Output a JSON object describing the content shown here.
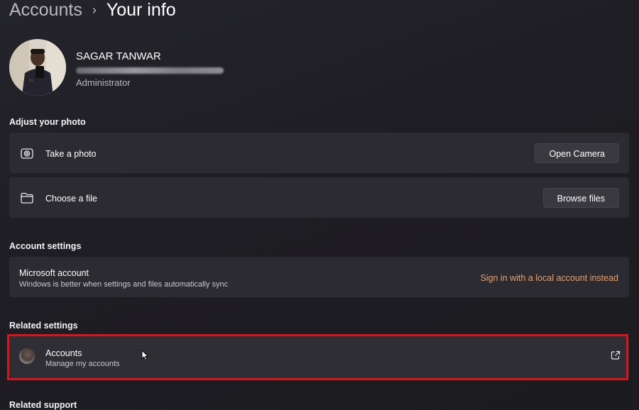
{
  "breadcrumb": {
    "parent": "Accounts",
    "separator": "›",
    "current": "Your info"
  },
  "profile": {
    "name": "SAGAR TANWAR",
    "role": "Administrator"
  },
  "adjust_photo": {
    "title": "Adjust your photo",
    "rows": [
      {
        "label": "Take a photo",
        "icon": "camera-icon",
        "button": "Open Camera"
      },
      {
        "label": "Choose a file",
        "icon": "folder-icon",
        "button": "Browse files"
      }
    ]
  },
  "account_settings": {
    "title": "Account settings",
    "label": "Microsoft account",
    "description": "Windows is better when settings and files automatically sync",
    "link": "Sign in with a local account instead"
  },
  "related_settings": {
    "title": "Related settings",
    "item": {
      "label": "Accounts",
      "description": "Manage my accounts",
      "icon": "external-link-icon"
    }
  },
  "related_support": {
    "title": "Related support"
  },
  "colors": {
    "background": "#1f1e24",
    "card": "#2c2b31",
    "accent_link": "#e8a070",
    "highlight": "#d8141c"
  }
}
